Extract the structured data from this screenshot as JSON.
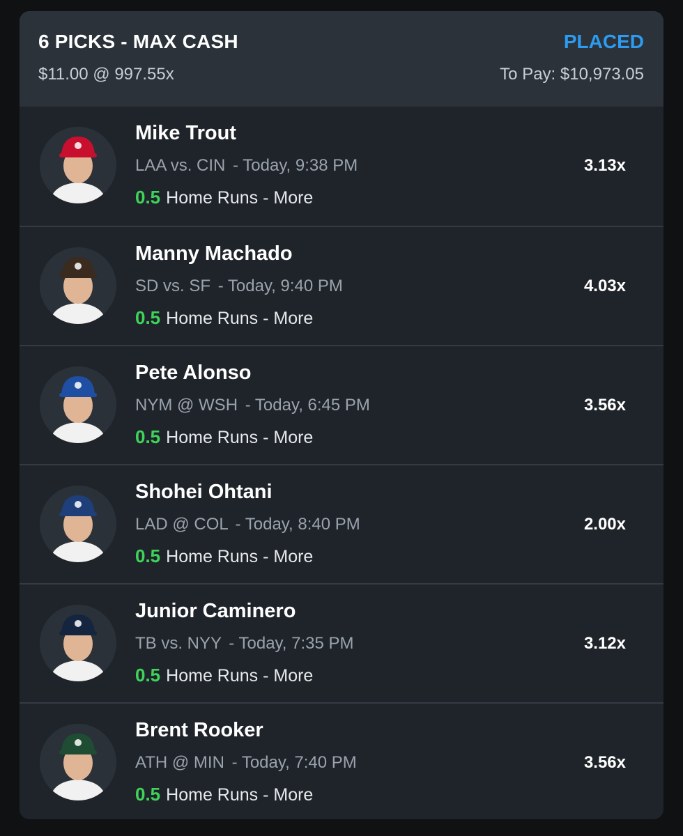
{
  "entry": {
    "title": "6 PICKS - MAX CASH",
    "status": "PLACED",
    "stake": "$11.00 @ 997.55x",
    "to_pay": "To Pay: $10,973.05"
  },
  "colors": {
    "accent_blue": "#2d9bf0",
    "line_green": "#3ed45a",
    "card_bg": "#1f242a",
    "header_bg": "#2b323a"
  },
  "picks": [
    {
      "player": "Mike Trout",
      "matchup": "LAA vs. CIN",
      "time": "- Today, 9:38 PM",
      "line": "0.5",
      "stat": "Home Runs - More",
      "multiplier": "3.13x",
      "cap_color": "#c8102e",
      "logo": "angels-logo-icon"
    },
    {
      "player": "Manny Machado",
      "matchup": "SD vs. SF",
      "time": "- Today, 9:40 PM",
      "line": "0.5",
      "stat": "Home Runs - More",
      "multiplier": "4.03x",
      "cap_color": "#3b2a1e",
      "logo": "padres-logo-icon"
    },
    {
      "player": "Pete Alonso",
      "matchup": "NYM @ WSH",
      "time": "- Today, 6:45 PM",
      "line": "0.5",
      "stat": "Home Runs - More",
      "multiplier": "3.56x",
      "cap_color": "#1f4fa3",
      "logo": "mets-logo-icon"
    },
    {
      "player": "Shohei Ohtani",
      "matchup": "LAD @ COL",
      "time": "- Today, 8:40 PM",
      "line": "0.5",
      "stat": "Home Runs - More",
      "multiplier": "2.00x",
      "cap_color": "#1e3f7a",
      "logo": "dodgers-logo-icon"
    },
    {
      "player": "Junior Caminero",
      "matchup": "TB vs. NYY",
      "time": "- Today, 7:35 PM",
      "line": "0.5",
      "stat": "Home Runs - More",
      "multiplier": "3.12x",
      "cap_color": "#16253f",
      "logo": "rays-logo-icon"
    },
    {
      "player": "Brent Rooker",
      "matchup": "ATH @ MIN",
      "time": "- Today, 7:40 PM",
      "line": "0.5",
      "stat": "Home Runs - More",
      "multiplier": "3.56x",
      "cap_color": "#1f4d33",
      "logo": "athletics-logo-icon"
    }
  ]
}
